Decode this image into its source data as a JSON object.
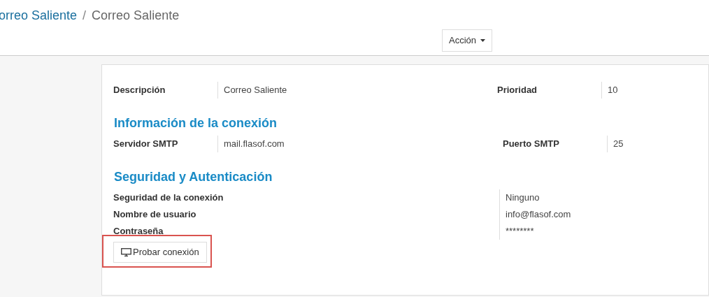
{
  "breadcrumb": [
    {
      "label": "orreo Saliente",
      "kind": "link"
    },
    {
      "label": "/",
      "kind": "separator"
    },
    {
      "label": "Correo Saliente",
      "kind": "current"
    }
  ],
  "action_button": {
    "label": "Acción"
  },
  "top_fields": [
    {
      "label": "Descripción",
      "value": "Correo Saliente",
      "side_label": "Prioridad",
      "side_value": "10"
    }
  ],
  "sections": [
    {
      "title": "Información de la conexión",
      "fields": [
        {
          "label": "Servidor SMTP",
          "value": "mail.flasof.com",
          "side_label": "Puerto SMTP",
          "side_value": "25"
        }
      ]
    },
    {
      "title": "Seguridad y Autenticación",
      "list_fields": [
        {
          "label": "Seguridad de la conexión",
          "value": "Ninguno"
        },
        {
          "label": "Nombre de usuario",
          "value": "info@flasof.com"
        },
        {
          "label": "Contraseña",
          "value": "********"
        }
      ]
    }
  ],
  "test_button": {
    "label": "Probar conexión",
    "highlighted": true
  }
}
